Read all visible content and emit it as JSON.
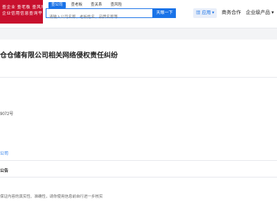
{
  "header": {
    "logo_lines": [
      "查企业 查老板 查风险",
      "企业信用信息查询平台"
    ],
    "tabs": [
      "查公司",
      "查老板",
      "查关系",
      "查风险"
    ],
    "search_placeholder": "请输入公司名称、老板姓名、品牌名称等",
    "search_button": "天眼一下",
    "app_button": "应用",
    "nav_cooperation": "商务合作",
    "nav_enterprise": "企业级产品"
  },
  "page": {
    "title": "仓仓储有限公司相关网络侵权责任纠纷",
    "case_number": "9072号",
    "company_link": "公司",
    "notice_label": "公告",
    "footer_note": "保证内容的真实性、准确性，请你使用信息前自行进一步核实"
  }
}
